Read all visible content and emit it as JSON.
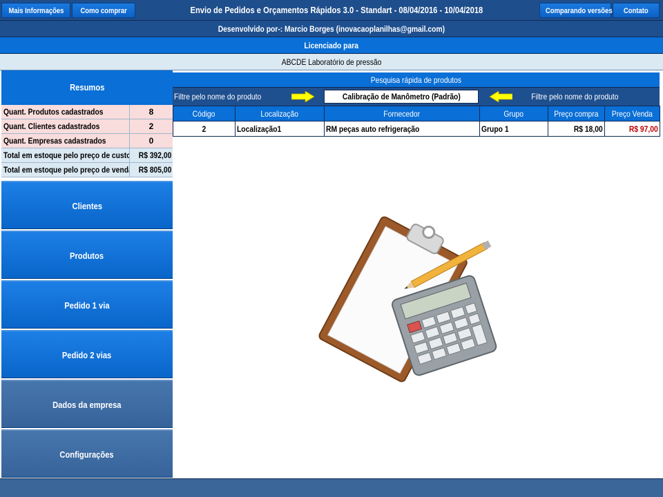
{
  "header": {
    "buttons_left": [
      "Mais Informações",
      "Como comprar"
    ],
    "title": "Envio de Pedidos e Orçamentos Rápidos 3.0 - Standart - 08/04/2016 - 10/04/2018",
    "buttons_right": [
      "Comparando versões",
      "Contato"
    ]
  },
  "developer": "Desenvolvido por-:  Marcio Borges  (inovacaoplanilhas@gmail.com)",
  "license_label": "Licenciado para",
  "company_name": "ABCDE Laboratório de pressão",
  "summary": {
    "title": "Resumos",
    "rows": [
      {
        "label": "Quant. Produtos cadastrados",
        "value": "8"
      },
      {
        "label": "Quant. Clientes cadastrados",
        "value": "2"
      },
      {
        "label": "Quant. Empresas cadastrados",
        "value": "0"
      },
      {
        "label": "Total em estoque pelo preço de custo",
        "value": "R$ 392,00"
      },
      {
        "label": "Total em estoque pelo preço de venda",
        "value": "R$ 805,00"
      }
    ]
  },
  "nav": [
    "Clientes",
    "Produtos",
    "Pedido 1 via",
    "Pedido 2 vias",
    "Dados da empresa",
    "Configurações"
  ],
  "search": {
    "title": "Pesquisa rápida de produtos",
    "filter_left": "Filtre pelo nome do produto",
    "selected_product": "Calibração de Manômetro (Padrão)",
    "filter_right": "Filtre pelo nome do produto"
  },
  "table": {
    "columns": [
      "Código",
      "Localização",
      "Fornecedor",
      "Grupo",
      "Preço compra",
      "Preço Venda"
    ],
    "rows": [
      [
        "2",
        "Localização1",
        "RM peças auto refrigeração",
        "Grupo 1",
        "R$ 18,00",
        "R$ 97,00"
      ]
    ]
  },
  "colors": {
    "accent": "#0a6fd6",
    "dark": "#1e4f8f",
    "sale_price": "#c00000",
    "arrow": "#ffff00"
  },
  "icons": [
    "right-arrow-icon",
    "left-arrow-icon",
    "clipboard-calculator-illustration"
  ]
}
